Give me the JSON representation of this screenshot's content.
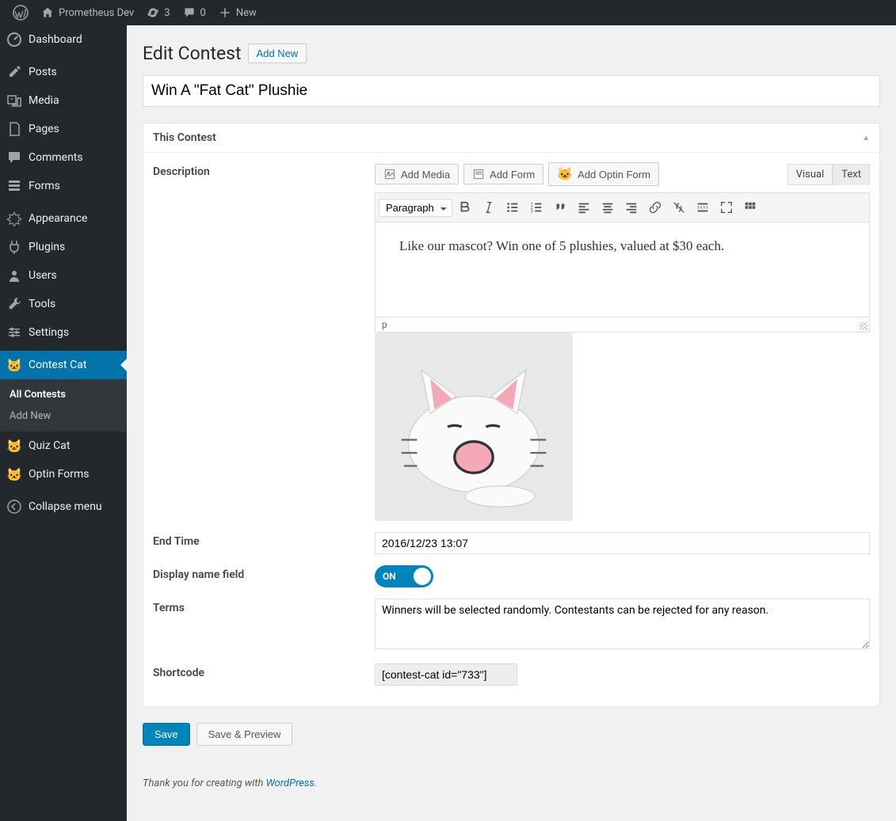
{
  "topbar": {
    "site_name": "Prometheus Dev",
    "updates_count": "3",
    "comments_count": "0",
    "new_label": "New"
  },
  "sidebar": {
    "items": [
      {
        "label": "Dashboard",
        "icon": "dashboard"
      },
      {
        "label": "Posts",
        "icon": "pin"
      },
      {
        "label": "Media",
        "icon": "media"
      },
      {
        "label": "Pages",
        "icon": "pages"
      },
      {
        "label": "Comments",
        "icon": "comment"
      },
      {
        "label": "Forms",
        "icon": "forms"
      },
      {
        "label": "Appearance",
        "icon": "appearance"
      },
      {
        "label": "Plugins",
        "icon": "plugin"
      },
      {
        "label": "Users",
        "icon": "users"
      },
      {
        "label": "Tools",
        "icon": "tools"
      },
      {
        "label": "Settings",
        "icon": "settings"
      },
      {
        "label": "Contest Cat",
        "icon": "cat",
        "current": true
      },
      {
        "label": "Quiz Cat",
        "icon": "cat"
      },
      {
        "label": "Optin Forms",
        "icon": "cat"
      }
    ],
    "submenu": [
      {
        "label": "All Contests",
        "current": true
      },
      {
        "label": "Add New"
      }
    ],
    "collapse_label": "Collapse menu"
  },
  "page": {
    "title": "Edit Contest",
    "add_new": "Add New",
    "title_value": "Win A \"Fat Cat\" Plushie"
  },
  "panel": {
    "heading": "This Contest",
    "description_label": "Description",
    "add_media": "Add Media",
    "add_form": "Add Form",
    "add_optin": "Add Optin Form",
    "visual_tab": "Visual",
    "text_tab": "Text",
    "format_value": "Paragraph",
    "editor_content": "Like our mascot? Win one of 5 plushies, valued at $30 each.",
    "editor_path": "p",
    "end_time_label": "End Time",
    "end_time_value": "2016/12/23 13:07",
    "display_name_label": "Display name field",
    "toggle_text": "ON",
    "terms_label": "Terms",
    "terms_value": "Winners will be selected randomly. Contestants can be rejected for any reason.",
    "shortcode_label": "Shortcode",
    "shortcode_value": "[contest-cat id=\"733\"]"
  },
  "actions": {
    "save": "Save",
    "save_preview": "Save & Preview"
  },
  "footer": {
    "thanks": "Thank you for creating with ",
    "link_text": "WordPress",
    "period": "."
  }
}
